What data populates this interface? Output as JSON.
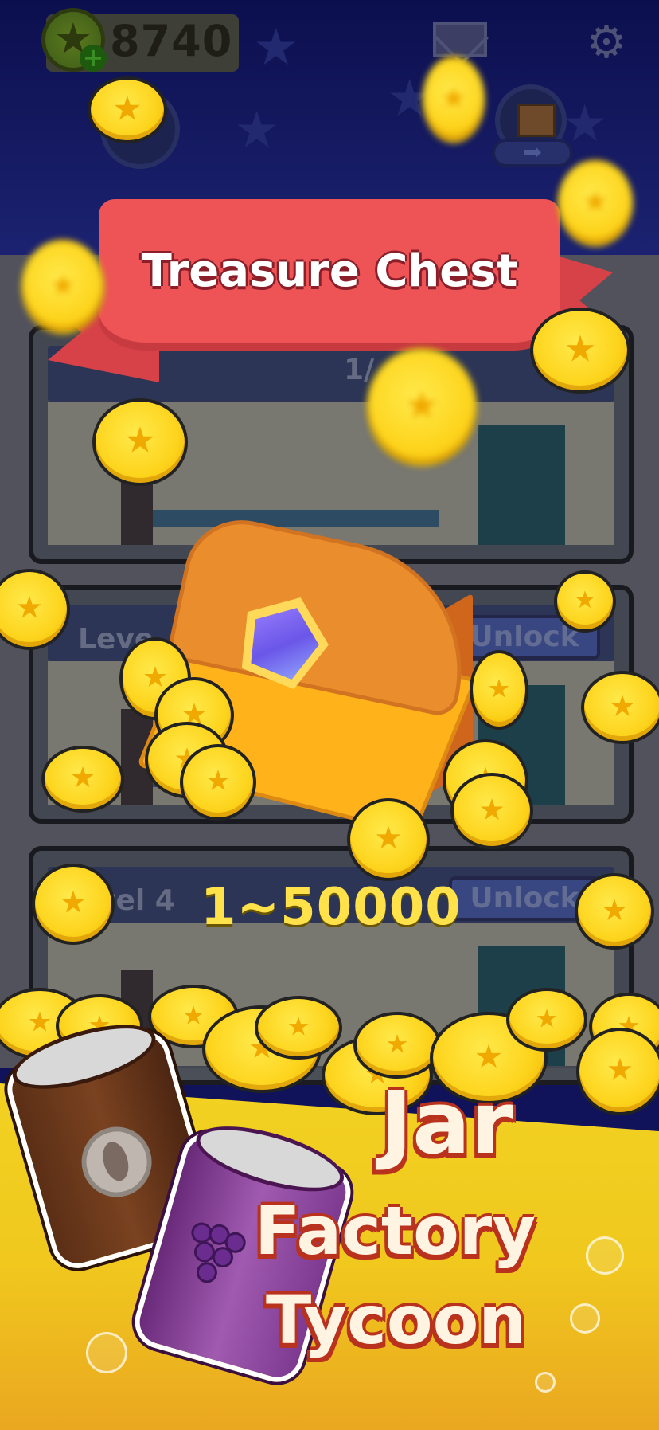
{
  "hud": {
    "coin_count": "8740",
    "plus_label": "+"
  },
  "icons": {
    "mail": "mail-icon",
    "settings": "gear-icon",
    "gear_glyph": "⚙",
    "arrow_glyph": "➡"
  },
  "banner": {
    "title": "Treasure Chest"
  },
  "factory": {
    "floors": [
      {
        "level_label": "Leve",
        "unlock_label": "Unlock"
      },
      {
        "level_label": "vel 4",
        "unlock_label": "Unlock"
      }
    ],
    "top_floor_counter": "1/"
  },
  "reward": {
    "range": "1~50000"
  },
  "promo": {
    "title_line1": "Jar",
    "title_line2": "Factory",
    "title_line3": "Tycoon"
  },
  "colors": {
    "sky": "#10135a",
    "banner_red": "#ee5356",
    "coin_gold": "#fdd41d",
    "reward_text": "#ffe24a",
    "promo_yellow": "#f2d322"
  }
}
